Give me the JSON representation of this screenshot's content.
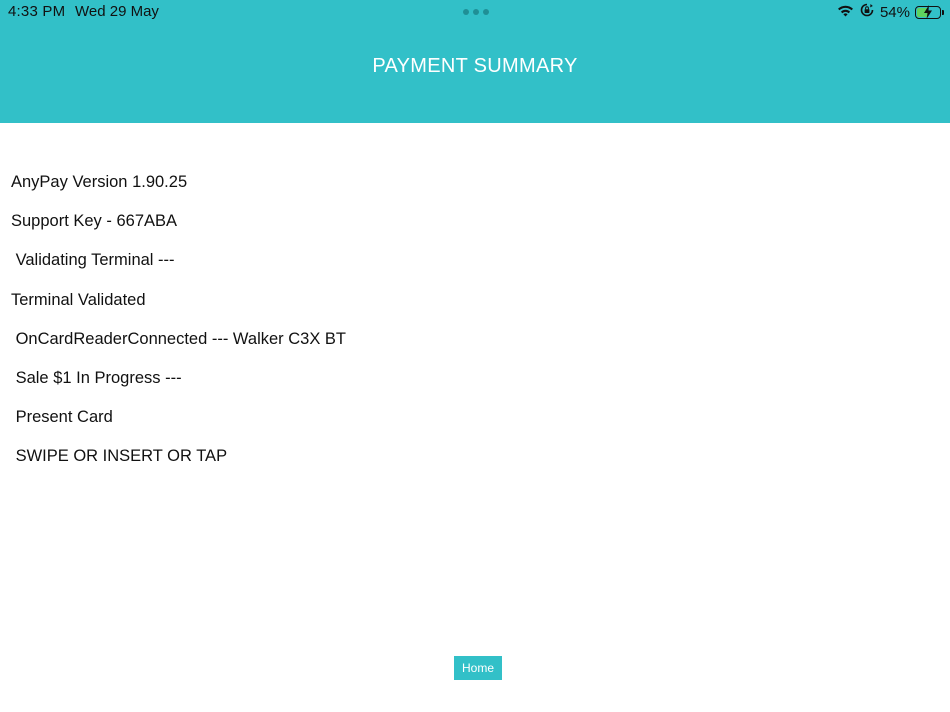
{
  "status_bar": {
    "time": "4:33 PM",
    "date": "Wed 29 May",
    "battery_percent_label": "54%",
    "battery_level": 0.54,
    "icons": [
      "more-dots-icon",
      "wifi-icon",
      "orientation-lock-icon",
      "battery-charging-icon"
    ]
  },
  "header": {
    "title": "PAYMENT SUMMARY",
    "background_color": "#32c0c8"
  },
  "log_lines": [
    "AnyPay Version 1.90.25",
    "Support Key - 667ABA",
    " Validating Terminal ---",
    "Terminal Validated",
    " OnCardReaderConnected --- Walker C3X BT",
    " Sale $1 In Progress ---",
    " Present Card",
    " SWIPE OR INSERT OR TAP"
  ],
  "footer": {
    "home_label": "Home"
  }
}
